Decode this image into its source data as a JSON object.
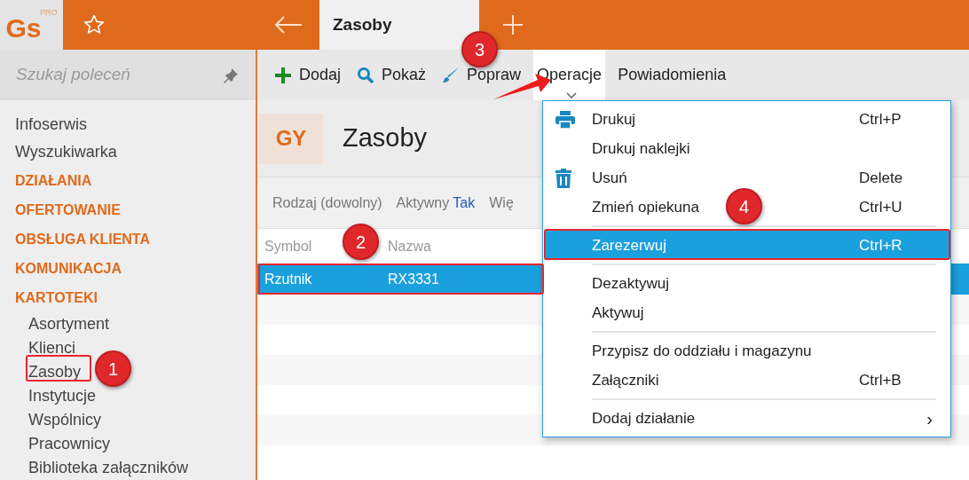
{
  "app": {
    "logo": "Gs",
    "logo_badge": "PRO"
  },
  "tabs": [
    {
      "label": "Zasoby",
      "selected": true
    }
  ],
  "sidebar": {
    "search": {
      "placeholder": "Szukaj poleceń"
    },
    "items": [
      {
        "kind": "link",
        "label": "Infoserwis"
      },
      {
        "kind": "link",
        "label": "Wyszukiwarka"
      },
      {
        "kind": "section",
        "label": "DZIAŁANIA"
      },
      {
        "kind": "section",
        "label": "OFERTOWANIE"
      },
      {
        "kind": "section",
        "label": "OBSŁUGA KLIENTA"
      },
      {
        "kind": "section",
        "label": "KOMUNIKACJA"
      },
      {
        "kind": "section",
        "label": "KARTOTEKI",
        "children": [
          {
            "label": "Asortyment"
          },
          {
            "label": "Klienci"
          },
          {
            "label": "Zasoby"
          },
          {
            "label": "Instytucje"
          },
          {
            "label": "Wspólnicy"
          },
          {
            "label": "Pracownicy"
          },
          {
            "label": "Biblioteka załączników"
          }
        ]
      }
    ]
  },
  "toolbar": [
    {
      "label": "Dodaj",
      "open": false
    },
    {
      "label": "Pokaż",
      "open": false
    },
    {
      "label": "Popraw",
      "open": false
    },
    {
      "label": "Operacje",
      "open": true
    },
    {
      "label": "Powiadomienia",
      "open": false
    }
  ],
  "header": {
    "badge": "GY",
    "title": "Zasoby"
  },
  "filters": [
    {
      "label": "Rodzaj (dowolny)"
    },
    {
      "label": "Aktywny",
      "value": "Tak"
    },
    {
      "label": "Wię"
    }
  ],
  "table": {
    "columns": [
      "Symbol",
      "Nazwa"
    ],
    "rows": [
      {
        "cells": [
          "Rzutnik",
          "RX3331"
        ],
        "selected": true
      }
    ]
  },
  "menu": [
    {
      "kind": "item",
      "label": "Drukuj",
      "shortcut": "Ctrl+P",
      "selected": false
    },
    {
      "kind": "item",
      "label": "Drukuj naklejki",
      "selected": false
    },
    {
      "kind": "item",
      "label": "Usuń",
      "shortcut": "Delete",
      "selected": false
    },
    {
      "kind": "item",
      "label": "Zmień opiekuna",
      "shortcut": "Ctrl+U",
      "selected": false
    },
    {
      "kind": "separator"
    },
    {
      "kind": "item",
      "label": "Zarezerwuj",
      "shortcut": "Ctrl+R",
      "selected": true
    },
    {
      "kind": "separator"
    },
    {
      "kind": "item",
      "label": "Dezaktywuj",
      "selected": false
    },
    {
      "kind": "item",
      "label": "Aktywuj",
      "selected": false
    },
    {
      "kind": "separator"
    },
    {
      "kind": "item",
      "label": "Przypisz do oddziału i magazynu",
      "selected": false
    },
    {
      "kind": "item",
      "label": "Załączniki",
      "shortcut": "Ctrl+B",
      "selected": false
    },
    {
      "kind": "separator"
    },
    {
      "kind": "item",
      "label": "Dodaj działanie",
      "submenu": "›",
      "selected": false
    }
  ],
  "callouts": [
    {
      "label": "1"
    },
    {
      "label": "2"
    },
    {
      "label": "3"
    },
    {
      "label": "4"
    }
  ]
}
